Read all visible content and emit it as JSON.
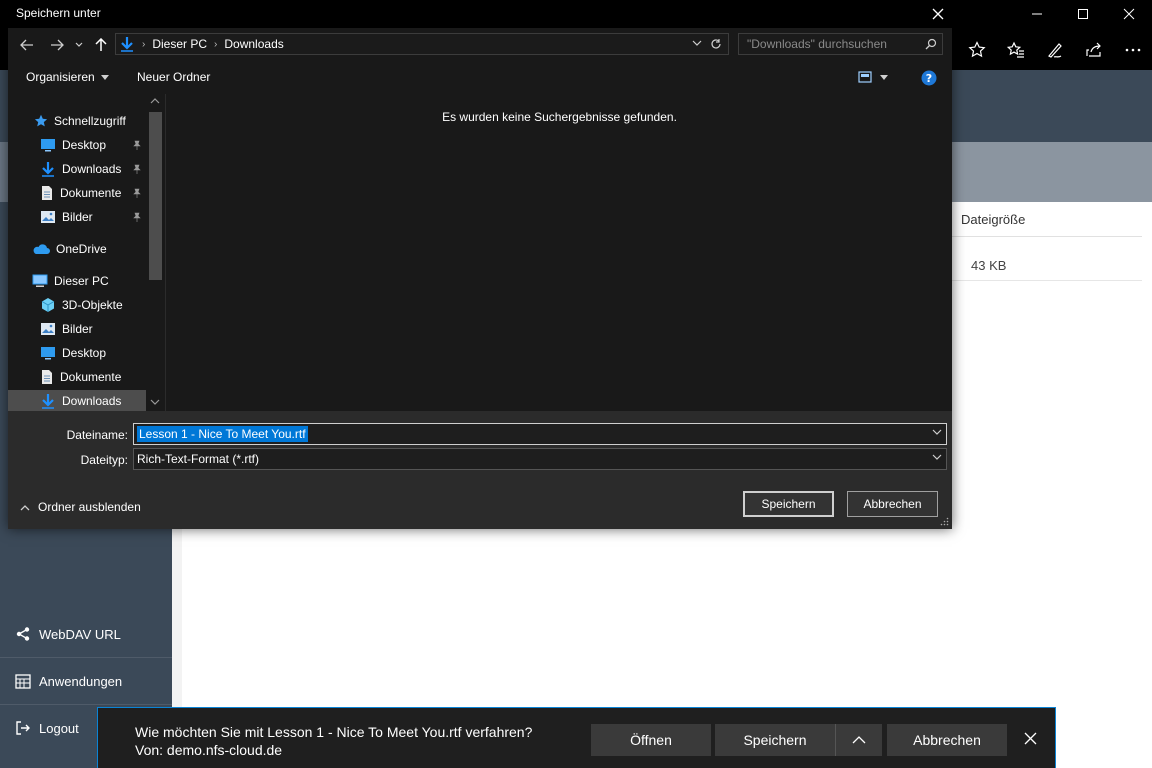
{
  "browser": {
    "app_header_title": "",
    "column_header": "Dateigröße",
    "file_size": "43 KB"
  },
  "sidebar": {
    "items": [
      {
        "label": "WebDAV URL",
        "icon": "share-icon"
      },
      {
        "label": "Anwendungen",
        "icon": "calendar-icon"
      },
      {
        "label": "Logout",
        "icon": "logout-icon"
      }
    ]
  },
  "download_bar": {
    "question": "Wie möchten Sie mit Lesson 1 - Nice To Meet You.rtf verfahren?",
    "source": "Von: demo.nfs-cloud.de",
    "open_label": "Öffnen",
    "save_label": "Speichern",
    "cancel_label": "Abbrechen"
  },
  "dialog": {
    "title": "Speichern unter",
    "breadcrumb": [
      "Dieser PC",
      "Downloads"
    ],
    "search_placeholder": "\"Downloads\" durchsuchen",
    "organize_label": "Organisieren",
    "new_folder_label": "Neuer Ordner",
    "empty_message": "Es wurden keine Suchergebnisse gefunden.",
    "nav_quick_access": "Schnellzugriff",
    "nav_quick": [
      {
        "label": "Desktop",
        "icon": "desktop-icon"
      },
      {
        "label": "Downloads",
        "icon": "downloads-icon"
      },
      {
        "label": "Dokumente",
        "icon": "documents-icon"
      },
      {
        "label": "Bilder",
        "icon": "pictures-icon"
      }
    ],
    "nav_onedrive": "OneDrive",
    "nav_this_pc": "Dieser PC",
    "nav_pc": [
      {
        "label": "3D-Objekte",
        "icon": "3d-objects-icon"
      },
      {
        "label": "Bilder",
        "icon": "pictures-icon"
      },
      {
        "label": "Desktop",
        "icon": "desktop-icon"
      },
      {
        "label": "Dokumente",
        "icon": "documents-icon"
      },
      {
        "label": "Downloads",
        "icon": "downloads-icon"
      }
    ],
    "filename_label": "Dateiname:",
    "filename_value": "Lesson 1 - Nice To Meet You.rtf",
    "filetype_label": "Dateityp:",
    "filetype_value": "Rich-Text-Format (*.rtf)",
    "hide_folders_label": "Ordner ausblenden",
    "save_label": "Speichern",
    "cancel_label": "Abbrechen"
  },
  "colors": {
    "accent": "#0078d7",
    "sidebar": "#3b4958",
    "dialog_bg": "#202020"
  }
}
